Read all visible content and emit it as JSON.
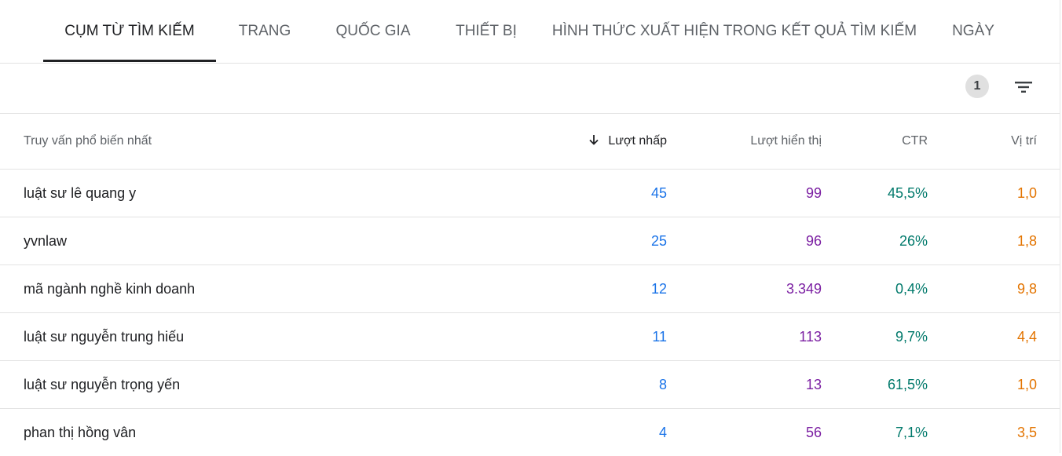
{
  "tabs": [
    {
      "label": "CỤM TỪ TÌM KIẾM",
      "active": true
    },
    {
      "label": "TRANG",
      "active": false
    },
    {
      "label": "QUỐC GIA",
      "active": false
    },
    {
      "label": "THIẾT BỊ",
      "active": false
    },
    {
      "label": "HÌNH THỨC XUẤT HIỆN TRONG KẾT QUẢ TÌM KIẾM",
      "active": false
    },
    {
      "label": "NGÀY",
      "active": false
    }
  ],
  "toolbar": {
    "filter_count": "1",
    "filter_icon": "filter-list-icon"
  },
  "table": {
    "headers": {
      "query": "Truy vấn phổ biến nhất",
      "clicks": "Lượt nhấp",
      "impressions": "Lượt hiển thị",
      "ctr": "CTR",
      "position": "Vị trí"
    },
    "sorted_by": "clicks",
    "sort_direction": "descending",
    "rows": [
      {
        "query": "luật sư lê quang y",
        "clicks": "45",
        "impressions": "99",
        "ctr": "45,5%",
        "position": "1,0"
      },
      {
        "query": "yvnlaw",
        "clicks": "25",
        "impressions": "96",
        "ctr": "26%",
        "position": "1,8"
      },
      {
        "query": "mã ngành nghề kinh doanh",
        "clicks": "12",
        "impressions": "3.349",
        "ctr": "0,4%",
        "position": "9,8"
      },
      {
        "query": "luật sư nguyễn trung hiếu",
        "clicks": "11",
        "impressions": "113",
        "ctr": "9,7%",
        "position": "4,4"
      },
      {
        "query": "luật sư nguyễn trọng yến",
        "clicks": "8",
        "impressions": "13",
        "ctr": "61,5%",
        "position": "1,0"
      },
      {
        "query": "phan thị hồng vân",
        "clicks": "4",
        "impressions": "56",
        "ctr": "7,1%",
        "position": "3,5"
      }
    ]
  },
  "colors": {
    "clicks": "#1a73e8",
    "impressions": "#7b1fa2",
    "ctr": "#00796b",
    "position": "#e37400"
  }
}
